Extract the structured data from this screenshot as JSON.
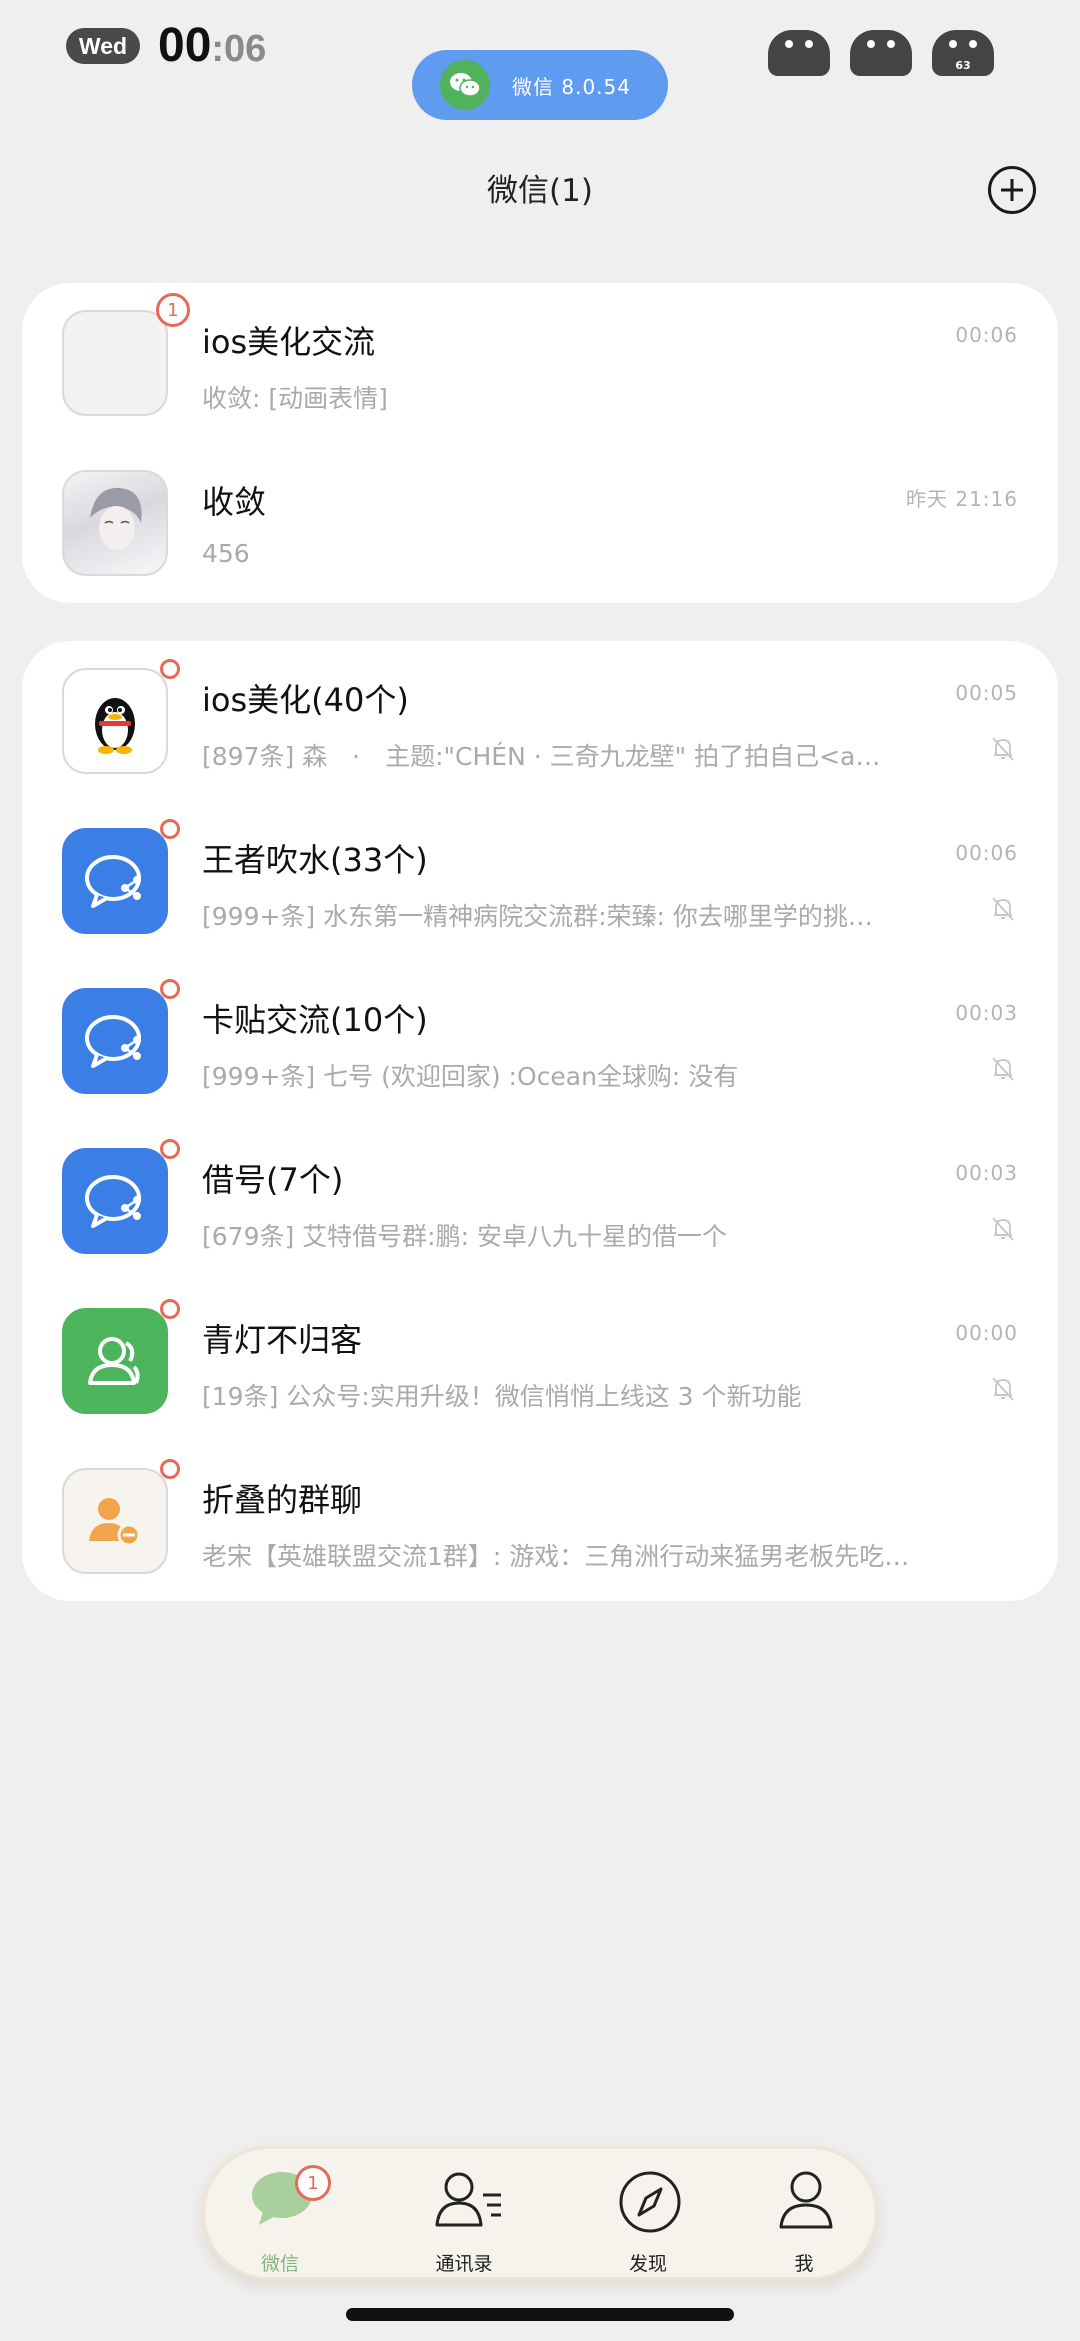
{
  "status_bar": {
    "day": "Wed",
    "hour": "00",
    "minute": ":06",
    "app_pill": "微信 8.0.54",
    "pet_badge": "63"
  },
  "header": {
    "title": "微信(1)"
  },
  "pinned": [
    {
      "title": "ios美化交流",
      "subtitle": "收敛: [动画表情]",
      "time": "00:06",
      "badge": "1"
    },
    {
      "title": "收敛",
      "subtitle": "456",
      "time": "昨天 21:16"
    }
  ],
  "groups": [
    {
      "title": "ios美化(40个)",
      "subtitle": "[897条] 森　·　主题:\"CHÉN · 三奇九龙壁\" 拍了拍自己<a…",
      "time": "00:05"
    },
    {
      "title": "王者吹水(33个)",
      "subtitle": "[999+条] 水东第一精神病院交流群:荣臻: 你去哪里学的挑…",
      "time": "00:06"
    },
    {
      "title": "卡贴交流(10个)",
      "subtitle": "[999+条] 七号 (欢迎回家) :Ocean全球购: 没有",
      "time": "00:03"
    },
    {
      "title": "借号(7个)",
      "subtitle": "[679条] 艾特借号群:鹏: 安卓八九十星的借一个",
      "time": "00:03"
    },
    {
      "title": "青灯不归客",
      "subtitle": "[19条] 公众号:实用升级！微信悄悄上线这 3 个新功能",
      "time": "00:00"
    },
    {
      "title": "折叠的群聊",
      "subtitle": "老宋【英雄联盟交流1群】: 游戏：三角洲行动来猛男老板先吃…",
      "time": ""
    }
  ],
  "tabs": [
    {
      "label": "微信",
      "badge": "1",
      "icon": "chat-bubble-icon"
    },
    {
      "label": "通讯录",
      "icon": "contacts-icon"
    },
    {
      "label": "发现",
      "icon": "compass-icon"
    },
    {
      "label": "我",
      "icon": "person-icon"
    }
  ],
  "colors": {
    "accent_blue": "#3b7ee6",
    "accent_green": "#4cb55c",
    "badge_red": "#e46a5a",
    "tab_active": "#7fb77f"
  }
}
